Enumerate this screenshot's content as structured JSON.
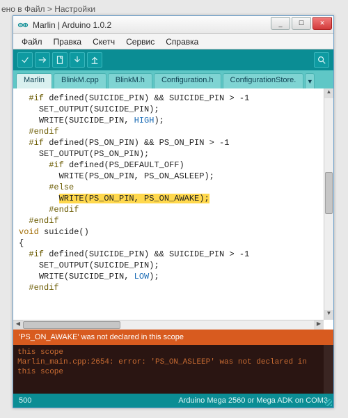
{
  "partial_breadcrumb": "ено в Файл > Настройки",
  "window": {
    "title": "Marlin | Arduino 1.0.2",
    "controls": {
      "min": "_",
      "max": "☐",
      "close": "✕"
    }
  },
  "menubar": [
    "Файл",
    "Правка",
    "Скетч",
    "Сервис",
    "Справка"
  ],
  "tabs": {
    "items": [
      "Marlin",
      "BlinkM.cpp",
      "BlinkM.h",
      "Configuration.h",
      "ConfigurationStore."
    ],
    "active_index": 0
  },
  "code_lines": [
    {
      "indent": 1,
      "segs": [
        {
          "t": "#if",
          "cls": "kw-pre"
        },
        {
          "t": " defined(SUICIDE_PIN) && SUICIDE_PIN > -1"
        }
      ]
    },
    {
      "indent": 2,
      "segs": [
        {
          "t": "SET_OUTPUT(SUICIDE_PIN);"
        }
      ]
    },
    {
      "indent": 2,
      "segs": [
        {
          "t": "WRITE(SUICIDE_PIN, "
        },
        {
          "t": "HIGH",
          "cls": "const"
        },
        {
          "t": ");"
        }
      ]
    },
    {
      "indent": 1,
      "segs": [
        {
          "t": "#endif",
          "cls": "kw-pre"
        }
      ]
    },
    {
      "indent": 1,
      "segs": [
        {
          "t": "#if",
          "cls": "kw-pre"
        },
        {
          "t": " defined(PS_ON_PIN) && PS_ON_PIN > -1"
        }
      ]
    },
    {
      "indent": 2,
      "segs": [
        {
          "t": "SET_OUTPUT(PS_ON_PIN);"
        }
      ]
    },
    {
      "indent": 3,
      "segs": [
        {
          "t": "#if",
          "cls": "kw-pre"
        },
        {
          "t": " defined(PS_DEFAULT_OFF)"
        }
      ]
    },
    {
      "indent": 4,
      "segs": [
        {
          "t": "WRITE(PS_ON_PIN, PS_ON_ASLEEP);"
        }
      ]
    },
    {
      "indent": 3,
      "segs": [
        {
          "t": "#else",
          "cls": "kw-pre"
        }
      ]
    },
    {
      "indent": 4,
      "segs": [
        {
          "t": "WRITE(PS_ON_PIN, PS_ON_AWAKE);",
          "hl": true
        }
      ]
    },
    {
      "indent": 3,
      "segs": [
        {
          "t": "#endif",
          "cls": "kw-pre"
        }
      ]
    },
    {
      "indent": 1,
      "segs": [
        {
          "t": "#endif",
          "cls": "kw-pre"
        }
      ]
    },
    {
      "indent": 0,
      "segs": [
        {
          "t": ""
        }
      ]
    },
    {
      "indent": 0,
      "segs": [
        {
          "t": "void",
          "cls": "kw-type"
        },
        {
          "t": " suicide()"
        }
      ]
    },
    {
      "indent": 0,
      "segs": [
        {
          "t": "{"
        }
      ]
    },
    {
      "indent": 1,
      "segs": [
        {
          "t": "#if",
          "cls": "kw-pre"
        },
        {
          "t": " defined(SUICIDE_PIN) && SUICIDE_PIN > -1"
        }
      ]
    },
    {
      "indent": 2,
      "segs": [
        {
          "t": "SET_OUTPUT(SUICIDE_PIN);"
        }
      ]
    },
    {
      "indent": 2,
      "segs": [
        {
          "t": "WRITE(SUICIDE_PIN, "
        },
        {
          "t": "LOW",
          "cls": "const"
        },
        {
          "t": ");"
        }
      ]
    },
    {
      "indent": 1,
      "segs": [
        {
          "t": "#endif",
          "cls": "kw-pre"
        }
      ]
    }
  ],
  "error_summary": "'PS_ON_AWAKE' was not declared in this scope",
  "console_lines": [
    "this scope",
    "Marlin_main.cpp:2654: error: 'PS_ON_ASLEEP' was not declared in this scope"
  ],
  "status": {
    "left": "500",
    "right": "Arduino Mega 2560 or Mega ADK on COM3"
  }
}
